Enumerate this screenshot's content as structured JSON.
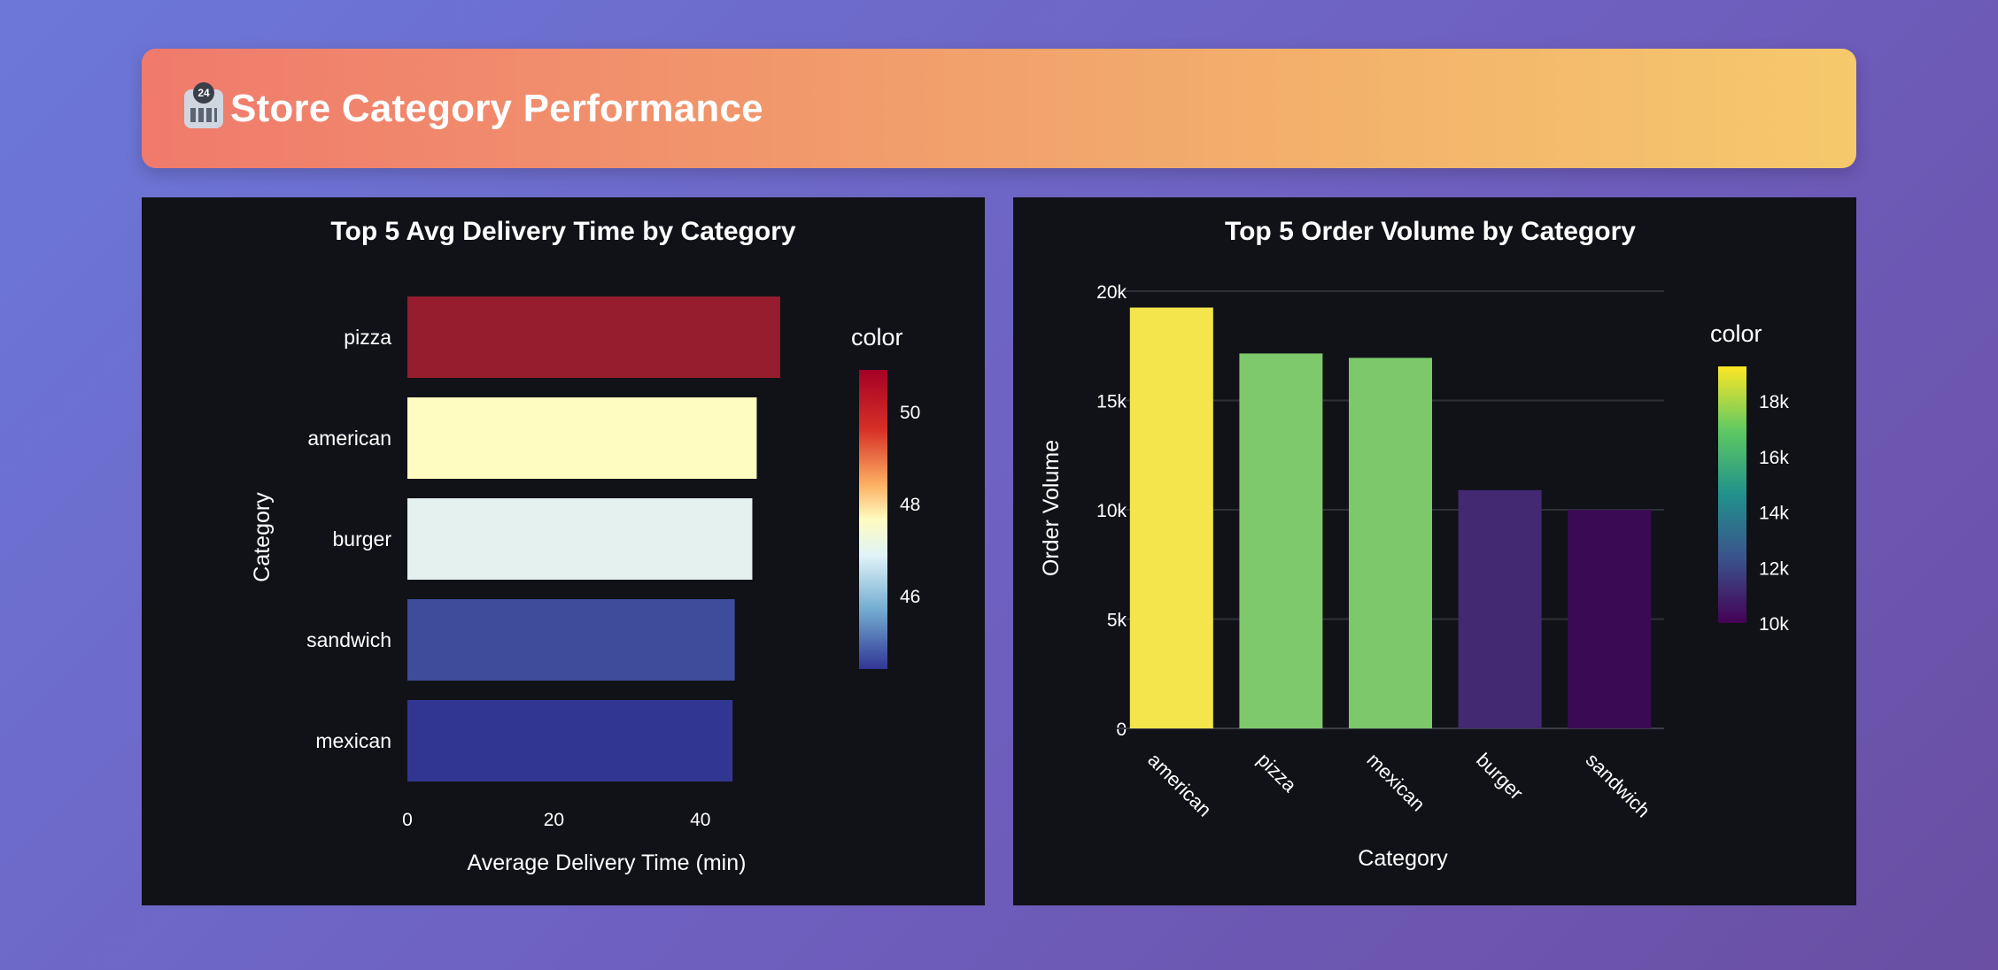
{
  "banner": {
    "icon_name": "convenience-store-icon",
    "icon_badge": "24",
    "title": "Store Category Performance"
  },
  "chart_data": [
    {
      "type": "bar",
      "orientation": "horizontal",
      "title": "Top 5 Avg Delivery Time by Category",
      "xlabel": "Average Delivery Time (min)",
      "ylabel": "Category",
      "categories": [
        "pizza",
        "american",
        "burger",
        "sandwich",
        "mexican"
      ],
      "values": [
        50.9,
        47.7,
        47.1,
        44.7,
        44.4
      ],
      "xlim": [
        0,
        52
      ],
      "xticks": [
        0,
        20,
        40
      ],
      "grid": false,
      "colorscale": "RdYlBu reversed",
      "colorbar": {
        "title": "color",
        "range": [
          44.4,
          50.9
        ],
        "ticks": [
          50,
          48,
          46
        ],
        "placement": "right"
      },
      "bar_colors": [
        "#961d2e",
        "#fefcc0",
        "#e5f1ef",
        "#3e4c9b",
        "#323693"
      ]
    },
    {
      "type": "bar",
      "orientation": "vertical",
      "title": "Top 5 Order Volume by Category",
      "xlabel": "Category",
      "ylabel": "Order Volume",
      "categories": [
        "american",
        "pizza",
        "mexican",
        "burger",
        "sandwich"
      ],
      "values": [
        19250,
        17150,
        16950,
        10900,
        10000
      ],
      "ylim": [
        0,
        20000
      ],
      "yticks": [
        0,
        5000,
        10000,
        15000,
        20000
      ],
      "ytick_labels": [
        "0",
        "5k",
        "10k",
        "15k",
        "20k"
      ],
      "grid": true,
      "colorscale": "Viridis",
      "colorbar": {
        "title": "color",
        "range": [
          10000,
          19250
        ],
        "ticks": [
          18000,
          16000,
          14000,
          12000,
          10000
        ],
        "tick_labels": [
          "18k",
          "16k",
          "14k",
          "12k",
          "10k"
        ],
        "placement": "right"
      },
      "bar_colors": [
        "#f5e54d",
        "#7ec96b",
        "#7cc86b",
        "#432872",
        "#3b0a54"
      ]
    }
  ]
}
